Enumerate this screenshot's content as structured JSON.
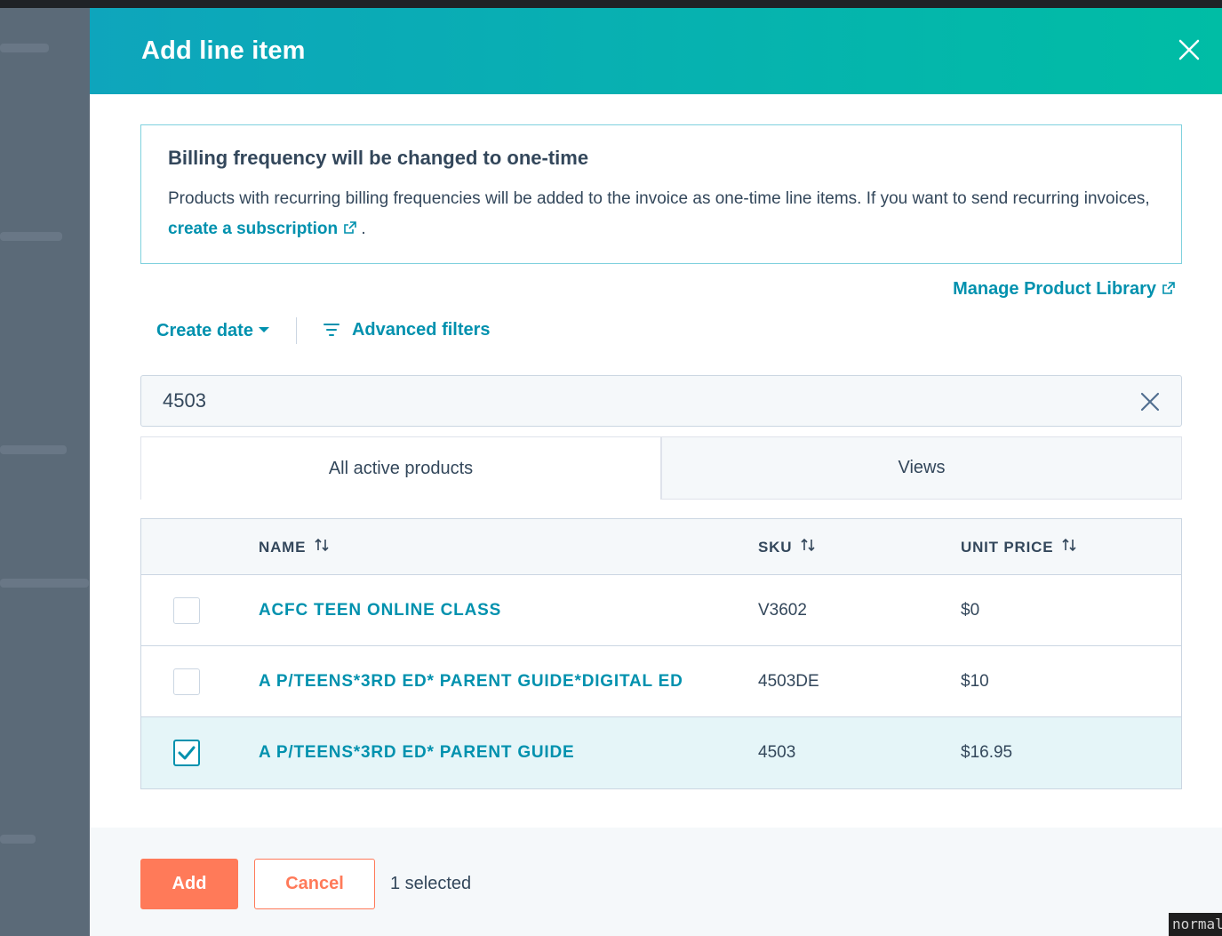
{
  "modal": {
    "title": "Add line item"
  },
  "alert": {
    "title": "Billing frequency will be changed to one-time",
    "body_text": "Products with recurring billing frequencies will be added to the invoice as one-time line items. If you want to send recurring invoices,",
    "link_label": "create a subscription",
    "after_link": "."
  },
  "manage_library_label": "Manage Product Library",
  "filters": {
    "create_date_label": "Create date",
    "advanced_label": "Advanced filters"
  },
  "search": {
    "value": "4503"
  },
  "tabs": [
    {
      "label": "All active products",
      "active": true
    },
    {
      "label": "Views",
      "active": false
    }
  ],
  "table": {
    "columns": [
      "NAME",
      "SKU",
      "UNIT PRICE"
    ],
    "rows": [
      {
        "name": "ACFC TEEN ONLINE CLASS",
        "sku": "V3602",
        "price": "$0",
        "checked": false
      },
      {
        "name": "A P/TEENS*3RD ED* PARENT GUIDE*DIGITAL ED",
        "sku": "4503DE",
        "price": "$10",
        "checked": false
      },
      {
        "name": "A P/TEENS*3RD ED* PARENT GUIDE",
        "sku": "4503",
        "price": "$16.95",
        "checked": true
      }
    ]
  },
  "footer": {
    "add_label": "Add",
    "cancel_label": "Cancel",
    "selected_text": "1 selected"
  },
  "editor_mode": "normal",
  "colors": {
    "accent": "#0091ae",
    "header_start": "#0ea5bc",
    "header_end": "#00bda5",
    "primary_button": "#ff7a59",
    "selected_row": "#e5f5f8"
  }
}
